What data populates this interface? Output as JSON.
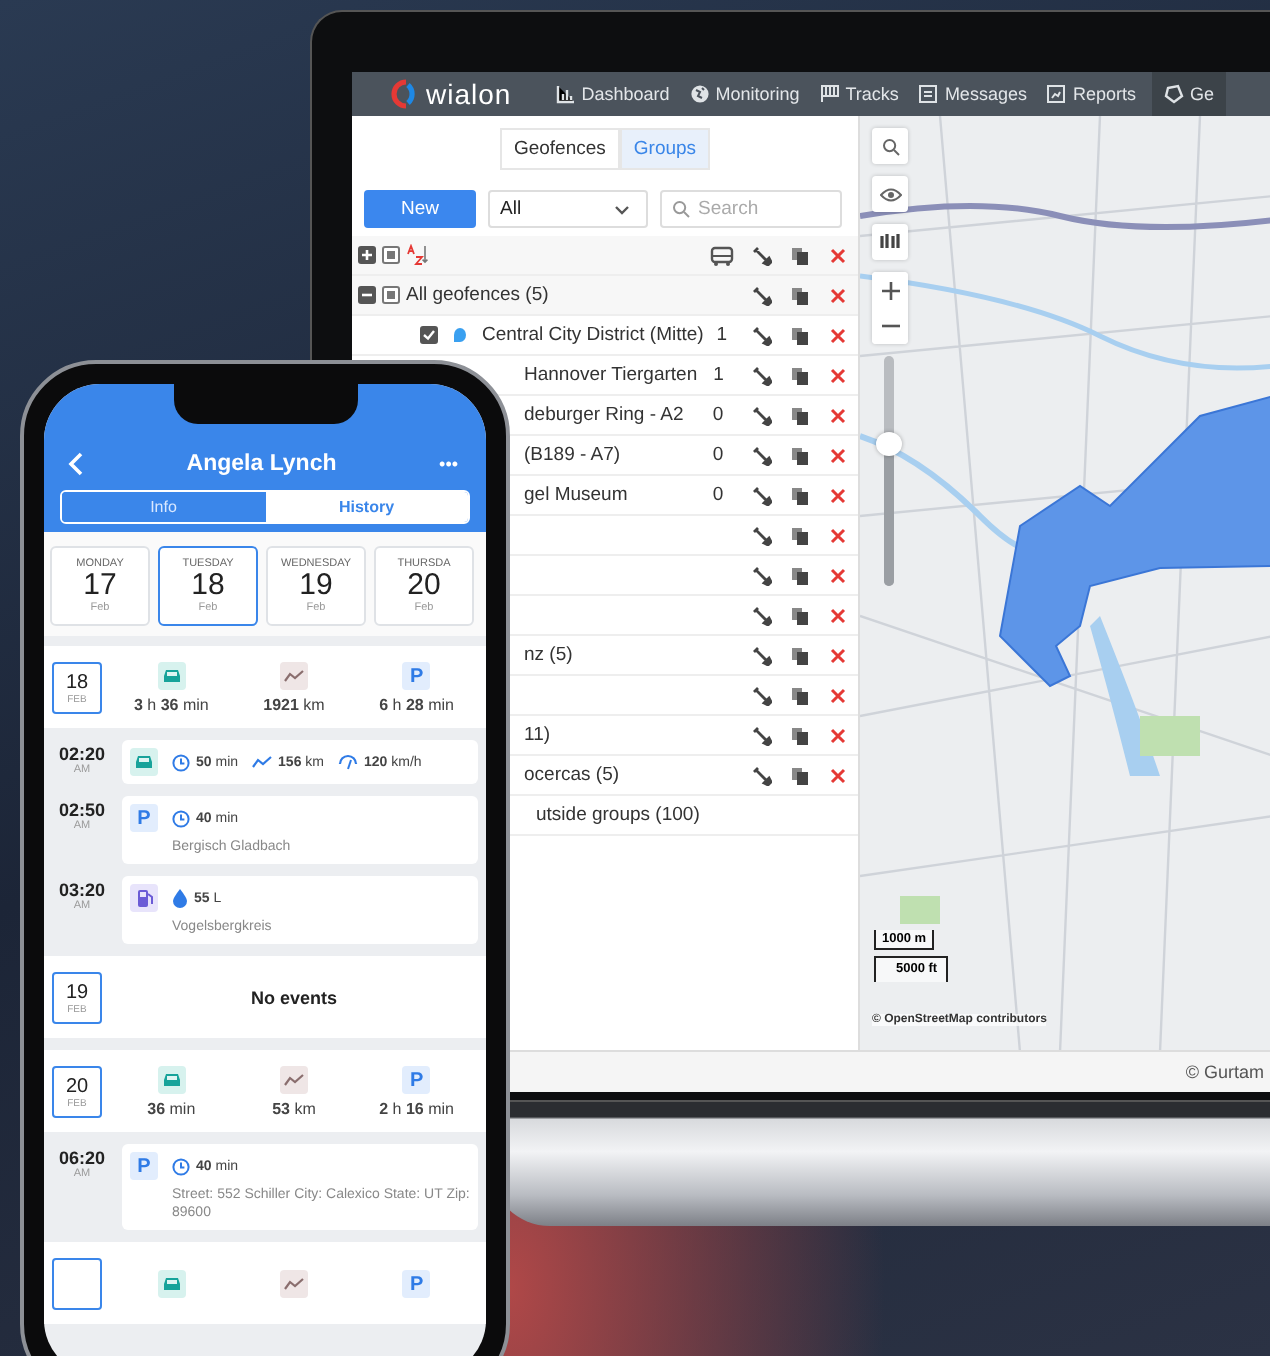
{
  "laptop": {
    "nav": {
      "logo": "wialon",
      "items": [
        {
          "label": "Dashboard",
          "selected": false
        },
        {
          "label": "Monitoring",
          "selected": false
        },
        {
          "label": "Tracks",
          "selected": false
        },
        {
          "label": "Messages",
          "selected": false
        },
        {
          "label": "Reports",
          "selected": false
        },
        {
          "label": "Ge",
          "selected": true
        }
      ]
    },
    "panel": {
      "tabs": [
        {
          "label": "Geofences",
          "selected": false
        },
        {
          "label": "Groups",
          "selected": true
        }
      ],
      "new_button": "New",
      "filter": {
        "value": "All"
      },
      "search": {
        "placeholder": "Search"
      },
      "rows": [
        {
          "kind": "header"
        },
        {
          "kind": "group",
          "name": "All geofences (5)",
          "expanded": true
        },
        {
          "kind": "geofence",
          "name": "Central City District (Mitte)",
          "count": "1",
          "checked": true,
          "color": "#3aa0f0"
        },
        {
          "kind": "covered",
          "name": "Hannover Tiergarten",
          "count": "1"
        },
        {
          "kind": "covered",
          "name": "deburger Ring - A2",
          "count": "0"
        },
        {
          "kind": "covered",
          "name": "(B189 - A7)",
          "count": "0"
        },
        {
          "kind": "covered",
          "name": "gel Museum",
          "count": "0"
        },
        {
          "kind": "covered"
        },
        {
          "kind": "covered"
        },
        {
          "kind": "covered"
        },
        {
          "kind": "covered",
          "name": "nz (5)"
        },
        {
          "kind": "covered"
        },
        {
          "kind": "covered",
          "name": "11)"
        },
        {
          "kind": "covered",
          "name": "ocercas (5)"
        },
        {
          "kind": "footer",
          "name": "utside groups (100)"
        }
      ]
    },
    "map": {
      "zoom": {
        "level": 0.62
      },
      "scale": [
        "1000 m",
        "5000 ft"
      ],
      "attribution": "© OpenStreetMap contributors"
    },
    "footer": "© Gurtam"
  },
  "phone": {
    "title": "Angela Lynch",
    "menu": "•••",
    "tabs": [
      {
        "label": "Info",
        "selected": false
      },
      {
        "label": "History",
        "selected": true
      }
    ],
    "days": [
      {
        "weekday": "MONDAY",
        "day": "17",
        "month": "Feb",
        "selected": false
      },
      {
        "weekday": "TUESDAY",
        "day": "18",
        "month": "Feb",
        "selected": true
      },
      {
        "weekday": "WEDNESDAY",
        "day": "19",
        "month": "Feb",
        "selected": false
      },
      {
        "weekday": "THURSDA",
        "day": "20",
        "month": "Feb",
        "selected": false
      }
    ],
    "feed": [
      {
        "kind": "day",
        "day": "18",
        "month": "FEB",
        "stats": [
          {
            "kind": "driving",
            "value": "**3** h **36** min"
          },
          {
            "kind": "mileage",
            "value": "**1921** km"
          },
          {
            "kind": "parking",
            "glyph": "P",
            "value": "**6** h **28** min"
          }
        ]
      },
      {
        "kind": "trip",
        "time": "02:20",
        "ampm": "AM",
        "metrics": [
          {
            "kind": "duration",
            "value": "**50** min"
          },
          {
            "kind": "mileage",
            "value": "**156** km"
          },
          {
            "kind": "speed",
            "value": "**120** km/h"
          }
        ]
      },
      {
        "kind": "parking",
        "time": "02:50",
        "ampm": "AM",
        "glyph": "P",
        "metrics": [
          {
            "kind": "duration",
            "value": "**40** min"
          }
        ],
        "address": "Bergisch Gladbach"
      },
      {
        "kind": "fuel",
        "time": "03:20",
        "ampm": "AM",
        "metrics": [
          {
            "kind": "volume",
            "value": "**55** L"
          }
        ],
        "address": "Vogelsbergkreis"
      },
      {
        "kind": "empty",
        "day": "19",
        "month": "FEB",
        "text": "No events"
      },
      {
        "kind": "day",
        "day": "20",
        "month": "FEB",
        "stats": [
          {
            "kind": "driving",
            "value": "**36** min"
          },
          {
            "kind": "mileage",
            "value": "**53** km"
          },
          {
            "kind": "parking",
            "glyph": "P",
            "value": "**2** h **16** min"
          }
        ]
      },
      {
        "kind": "parking",
        "time": "06:20",
        "ampm": "AM",
        "glyph": "P",
        "metrics": [
          {
            "kind": "duration",
            "value": "**40** min"
          }
        ],
        "address": "Street: 552 Schiller City: Calexico State: UT Zip: 89600"
      },
      {
        "kind": "day",
        "stats": [
          {
            "kind": "driving"
          },
          {
            "kind": "mileage"
          },
          {
            "kind": "parking",
            "glyph": "P"
          }
        ]
      }
    ]
  }
}
